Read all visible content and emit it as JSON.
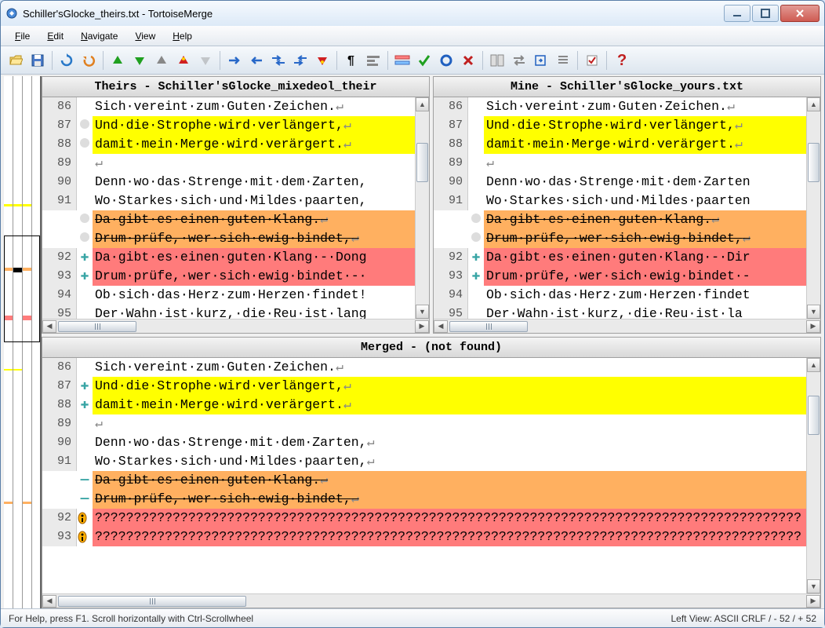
{
  "window": {
    "title": "Schiller'sGlocke_theirs.txt - TortoiseMerge"
  },
  "menu": {
    "file": "File",
    "edit": "Edit",
    "navigate": "Navigate",
    "view": "View",
    "help": "Help"
  },
  "panes": {
    "theirs_title": "Theirs - Schiller'sGlocke_mixedeol_their",
    "mine_title": "Mine - Schiller'sGlocke_yours.txt",
    "merged_title": "Merged -  (not found)"
  },
  "theirs_lines": [
    {
      "n": "86",
      "mk": "",
      "bg": "",
      "tx": "Sich·vereint·zum·Guten·Zeichen.↵"
    },
    {
      "n": "87",
      "mk": "o",
      "bg": "y",
      "tx": "Und·die·Strophe·wird·verlängert,↵"
    },
    {
      "n": "88",
      "mk": "o",
      "bg": "y",
      "tx": "damit·mein·Merge·wird·verärgert.↵"
    },
    {
      "n": "89",
      "mk": "",
      "bg": "",
      "tx": "↵"
    },
    {
      "n": "90",
      "mk": "",
      "bg": "",
      "tx": "Denn·wo·das·Strenge·mit·dem·Zarten,"
    },
    {
      "n": "91",
      "mk": "",
      "bg": "",
      "tx": "Wo·Starkes·sich·und·Mildes·paarten,"
    },
    {
      "n": "",
      "mk": "o",
      "bg": "o",
      "strike": true,
      "tx": "Da·gibt·es·einen·guten·Klang.↵"
    },
    {
      "n": "",
      "mk": "o",
      "bg": "o",
      "strike": true,
      "tx": "Drum·prüfe,·wer·sich·ewig·bindet,↵"
    },
    {
      "n": "92",
      "mk": "+",
      "bg": "r",
      "tx": "Da·gibt·es·einen·guten·Klang·-·Dong"
    },
    {
      "n": "93",
      "mk": "+",
      "bg": "r",
      "tx": "Drum·prüfe,·wer·sich·ewig·bindet·-·"
    },
    {
      "n": "94",
      "mk": "",
      "bg": "",
      "tx": "Ob·sich·das·Herz·zum·Herzen·findet!"
    },
    {
      "n": "95",
      "mk": "",
      "bg": "",
      "tx": "Der·Wahn·ist·kurz,·die·Reu·ist·lang"
    }
  ],
  "mine_lines": [
    {
      "n": "86",
      "mk": "",
      "bg": "",
      "tx": "Sich·vereint·zum·Guten·Zeichen.↵"
    },
    {
      "n": "87",
      "mk": "",
      "bg": "y",
      "tx": "Und·die·Strophe·wird·verlängert,↵"
    },
    {
      "n": "88",
      "mk": "",
      "bg": "y",
      "tx": "damit·mein·Merge·wird·verärgert.↵"
    },
    {
      "n": "89",
      "mk": "",
      "bg": "",
      "tx": "↵"
    },
    {
      "n": "90",
      "mk": "",
      "bg": "",
      "tx": "Denn·wo·das·Strenge·mit·dem·Zarten"
    },
    {
      "n": "91",
      "mk": "",
      "bg": "",
      "tx": "Wo·Starkes·sich·und·Mildes·paarten"
    },
    {
      "n": "",
      "mk": "o",
      "bg": "o",
      "strike": true,
      "tx": "Da·gibt·es·einen·guten·Klang.↵"
    },
    {
      "n": "",
      "mk": "o",
      "bg": "o",
      "strike": true,
      "tx": "Drum·prüfe,·wer·sich·ewig·bindet,↵"
    },
    {
      "n": "92",
      "mk": "+",
      "bg": "r",
      "tx": "Da·gibt·es·einen·guten·Klang·-·Dir"
    },
    {
      "n": "93",
      "mk": "+",
      "bg": "r",
      "tx": "Drum·prüfe,·wer·sich·ewig·bindet·-"
    },
    {
      "n": "94",
      "mk": "",
      "bg": "",
      "tx": "Ob·sich·das·Herz·zum·Herzen·findet"
    },
    {
      "n": "95",
      "mk": "",
      "bg": "",
      "tx": "Der·Wahn·ist·kurz,·die·Reu·ist·la"
    }
  ],
  "merged_lines": [
    {
      "n": "86",
      "mk": "",
      "bg": "",
      "tx": "Sich·vereint·zum·Guten·Zeichen.↵"
    },
    {
      "n": "87",
      "mk": "+",
      "bg": "y",
      "tx": "Und·die·Strophe·wird·verlängert,↵"
    },
    {
      "n": "88",
      "mk": "+",
      "bg": "y",
      "tx": "damit·mein·Merge·wird·verärgert.↵"
    },
    {
      "n": "89",
      "mk": "",
      "bg": "",
      "tx": "↵"
    },
    {
      "n": "90",
      "mk": "",
      "bg": "",
      "tx": "Denn·wo·das·Strenge·mit·dem·Zarten,↵"
    },
    {
      "n": "91",
      "mk": "",
      "bg": "",
      "tx": "Wo·Starkes·sich·und·Mildes·paarten,↵"
    },
    {
      "n": "",
      "mk": "-",
      "bg": "o",
      "strike": true,
      "tx": "Da·gibt·es·einen·guten·Klang.↵"
    },
    {
      "n": "",
      "mk": "-",
      "bg": "o",
      "strike": true,
      "tx": "Drum·prüfe,·wer·sich·ewig·bindet,↵"
    },
    {
      "n": "92",
      "mk": "!",
      "bg": "r",
      "tx": "???????????????????????????????????????????????????????????????????????????????????????????"
    },
    {
      "n": "93",
      "mk": "!",
      "bg": "r",
      "tx": "???????????????????????????????????????????????????????????????????????????????????????????"
    }
  ],
  "status": {
    "left": "For Help, press F1. Scroll horizontally with Ctrl-Scrollwheel",
    "right": "Left View: ASCII CRLF  / - 52 / + 52"
  }
}
